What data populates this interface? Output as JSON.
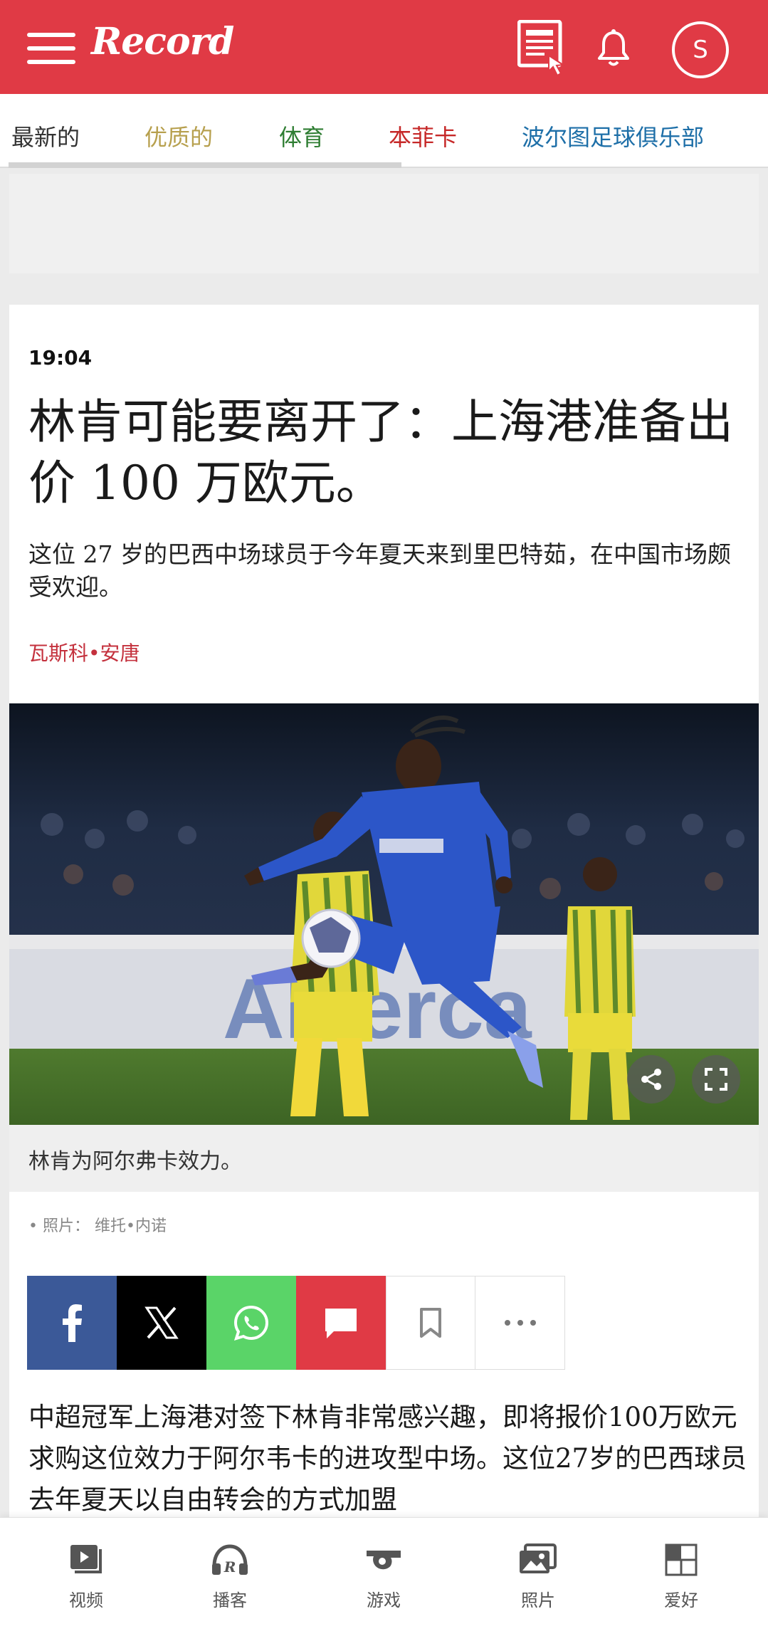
{
  "header": {
    "logo_text": "Record",
    "avatar_letter": "S",
    "bg_color": "#e03a45"
  },
  "tabs": [
    {
      "label": "最新的",
      "color": "#333333"
    },
    {
      "label": "优质的",
      "color": "#b7a04e"
    },
    {
      "label": "体育",
      "color": "#2e7d32"
    },
    {
      "label": "本菲卡",
      "color": "#c62828"
    },
    {
      "label": "波尔图足球俱乐部",
      "color": "#1e6fa8"
    }
  ],
  "article": {
    "time": "19:04",
    "headline": "林肯可能要离开了：上海港准备出价 100 万欧元。",
    "subtitle": "这位 27 岁的巴西中场球员于今年夏天来到里巴特茹，在中国市场颇受欢迎。",
    "author": "瓦斯科•安唐",
    "photo_caption": "林肯为阿尔弗卡效力。",
    "photo_credit": "• 照片： 维托•内诺",
    "body": "中超冠军上海港对签下林肯非常感兴趣，即将报价100万欧元求购这位效力于阿尔韦卡的进攻型中场。这位27岁的巴西球员去年夏天以自由转会的方式加盟"
  },
  "share_buttons": [
    {
      "name": "facebook",
      "icon": "facebook-icon",
      "color": "#3b5998"
    },
    {
      "name": "x",
      "icon": "x-icon",
      "color": "#000000"
    },
    {
      "name": "whatsapp",
      "icon": "whatsapp-icon",
      "color": "#5ad468"
    },
    {
      "name": "comments",
      "icon": "comment-icon",
      "color": "#e03a45"
    },
    {
      "name": "bookmark",
      "icon": "bookmark-icon",
      "color": "#ffffff"
    },
    {
      "name": "more",
      "icon": "more-icon",
      "color": "#ffffff"
    }
  ],
  "bottom_nav": [
    {
      "label": "视频",
      "icon": "video-icon"
    },
    {
      "label": "播客",
      "icon": "podcast-icon"
    },
    {
      "label": "游戏",
      "icon": "whistle-icon"
    },
    {
      "label": "照片",
      "icon": "photos-icon"
    },
    {
      "label": "爱好",
      "icon": "favorites-icon"
    }
  ]
}
